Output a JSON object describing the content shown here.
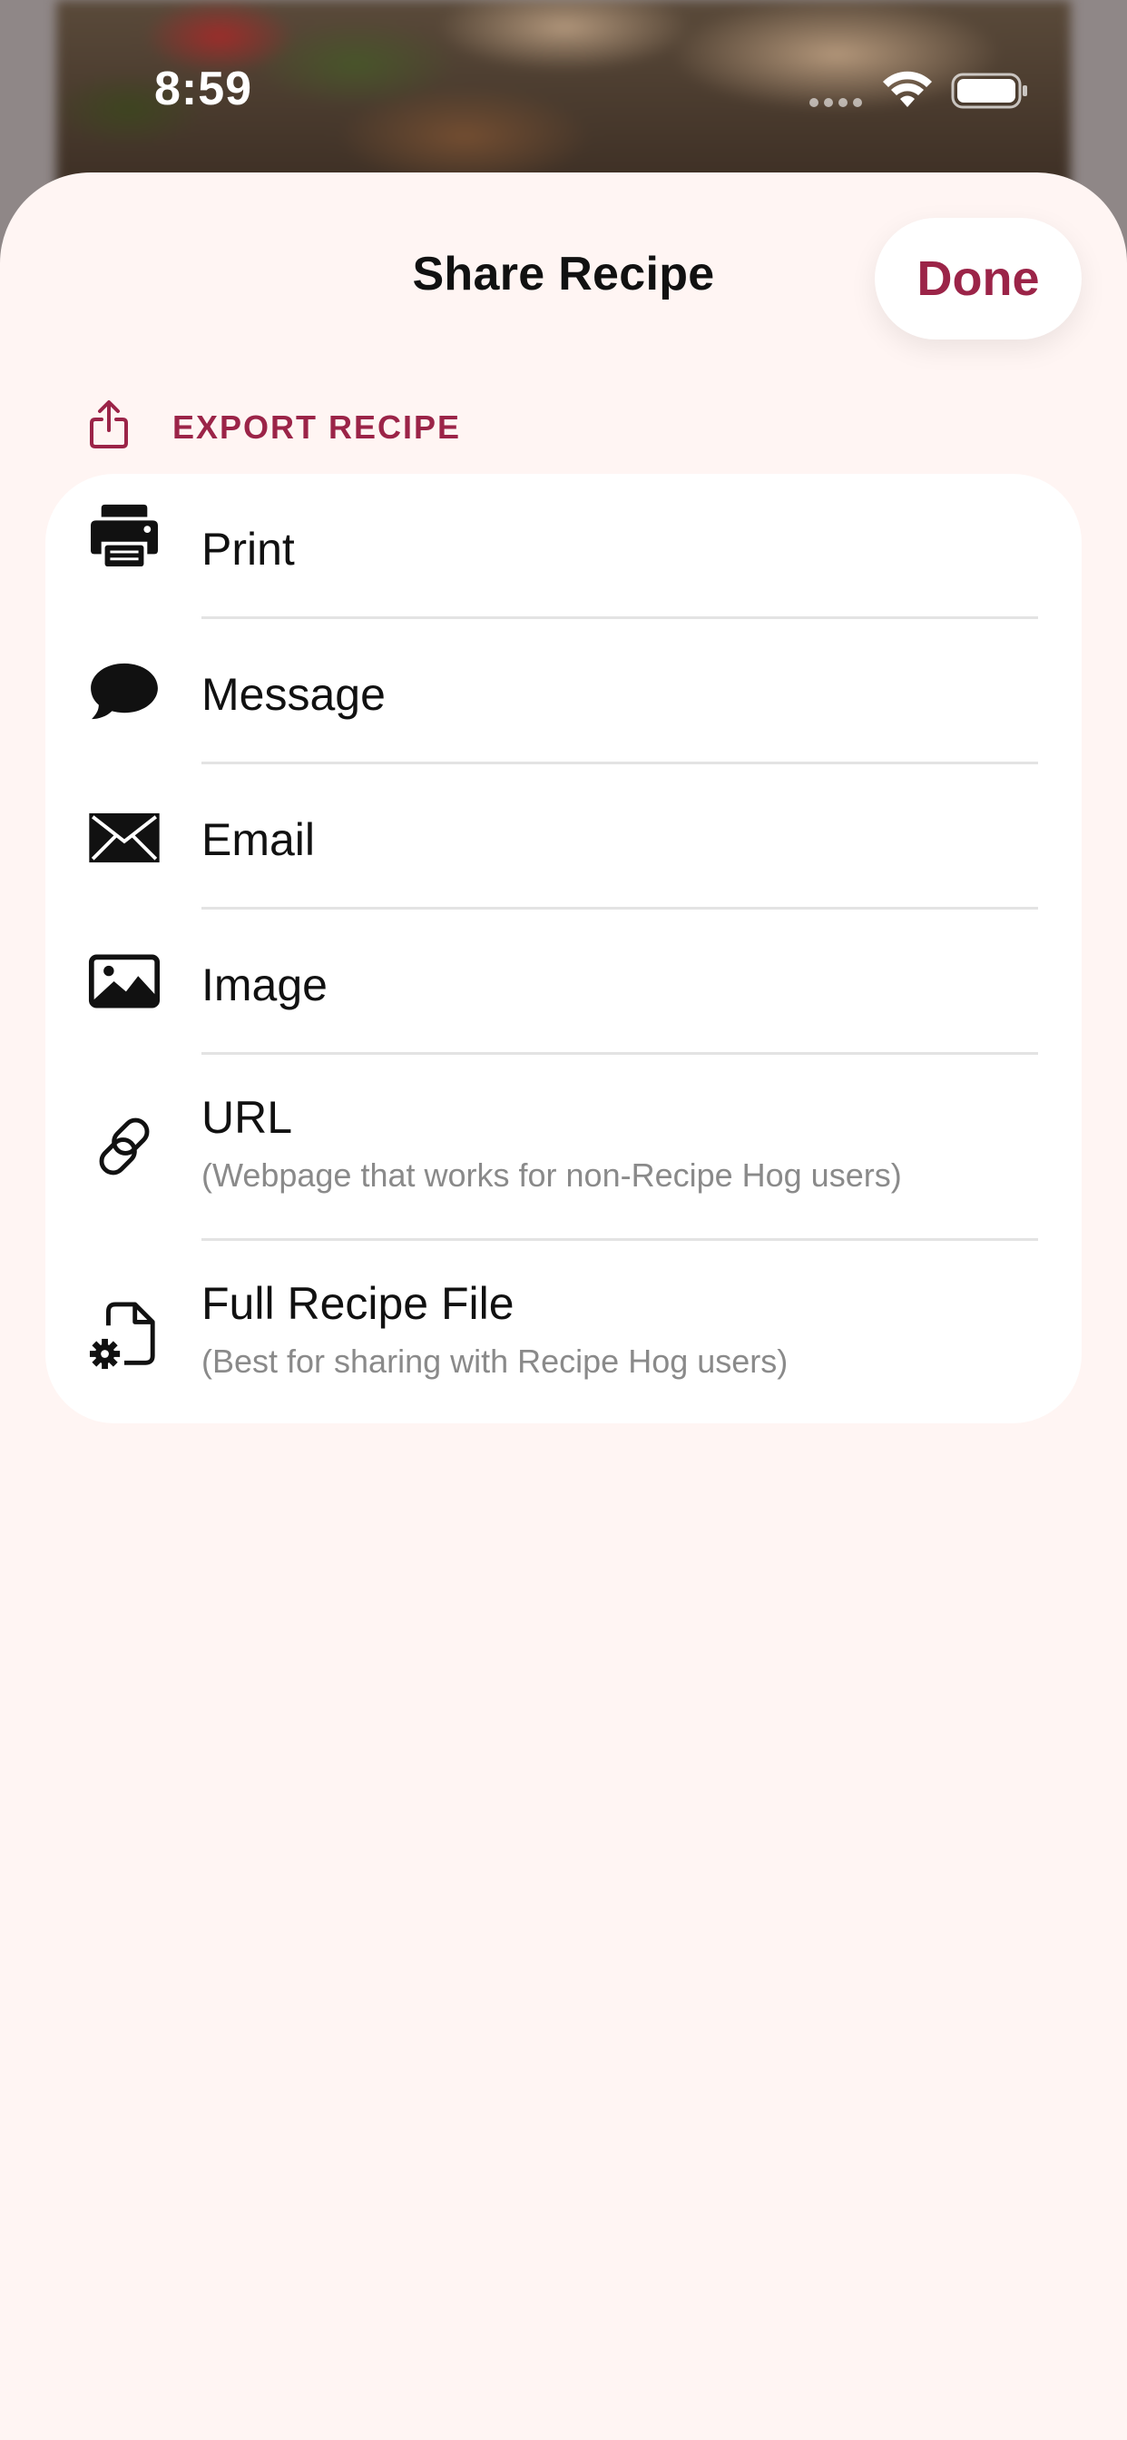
{
  "status_bar": {
    "time": "8:59"
  },
  "sheet": {
    "title": "Share Recipe",
    "done_label": "Done",
    "section_label": "EXPORT RECIPE"
  },
  "options": [
    {
      "icon": "printer-icon",
      "label": "Print",
      "subtitle": ""
    },
    {
      "icon": "message-bubble-icon",
      "label": "Message",
      "subtitle": ""
    },
    {
      "icon": "envelope-icon",
      "label": "Email",
      "subtitle": ""
    },
    {
      "icon": "photo-icon",
      "label": "Image",
      "subtitle": ""
    },
    {
      "icon": "link-icon",
      "label": "URL",
      "subtitle": "(Webpage that works for non-Recipe Hog users)"
    },
    {
      "icon": "document-gear-icon",
      "label": "Full Recipe File",
      "subtitle": "(Best for sharing with Recipe Hog users)"
    }
  ],
  "colors": {
    "accent": "#9b2448",
    "sheet_background": "#fff5f3",
    "card_background": "#ffffff"
  }
}
